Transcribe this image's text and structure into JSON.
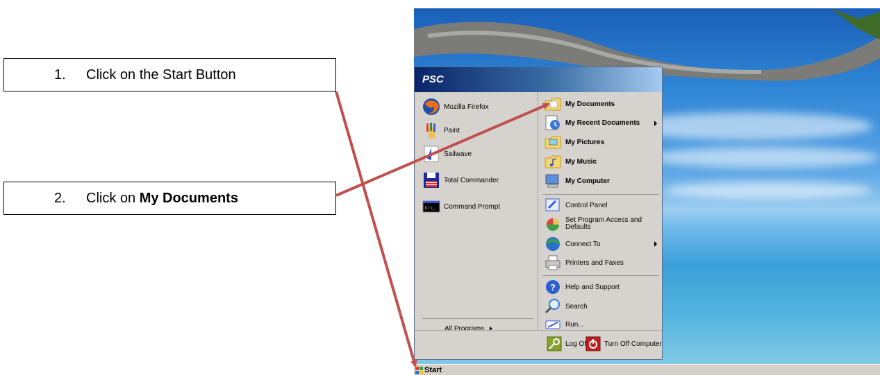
{
  "callouts": [
    {
      "number": "1.",
      "text": "Click on the Start Button",
      "bold": ""
    },
    {
      "number": "2.",
      "prefix": "Click on ",
      "bold": "My Documents"
    }
  ],
  "start_menu": {
    "user": "PSC",
    "left_items": [
      {
        "label": "Mozilla Firefox",
        "icon": "firefox-icon"
      },
      {
        "label": "Paint",
        "icon": "paint-icon"
      },
      {
        "label": "Sailwave",
        "icon": "sailwave-icon"
      },
      {
        "label": "Total Commander",
        "icon": "floppy-icon"
      },
      {
        "label": "Command Prompt",
        "icon": "cmd-icon"
      }
    ],
    "all_programs": "All Programs",
    "right_items": [
      {
        "label": "My Documents",
        "icon": "folder-icon"
      },
      {
        "label": "My Recent Documents",
        "icon": "recent-icon"
      },
      {
        "label": "My Pictures",
        "icon": "pictures-icon"
      },
      {
        "label": "My Music",
        "icon": "music-icon"
      },
      {
        "label": "My Computer",
        "icon": "computer-icon"
      },
      {
        "label": "Control Panel",
        "icon": "control-panel-icon"
      },
      {
        "label": "Set Program Access and Defaults",
        "icon": "program-access-icon"
      },
      {
        "label": "Connect To",
        "icon": "connect-icon"
      },
      {
        "label": "Printers and Faxes",
        "icon": "printer-icon"
      },
      {
        "label": "Help and Support",
        "icon": "help-icon"
      },
      {
        "label": "Search",
        "icon": "search-icon"
      },
      {
        "label": "Run...",
        "icon": "run-icon"
      }
    ],
    "log_off": "Log Off",
    "turn_off": "Turn Off Computer"
  },
  "taskbar": {
    "start_label": "Start"
  },
  "colors": {
    "arrow": "#c0504d",
    "header_start": "#0a246a",
    "header_end": "#a6caf0"
  }
}
